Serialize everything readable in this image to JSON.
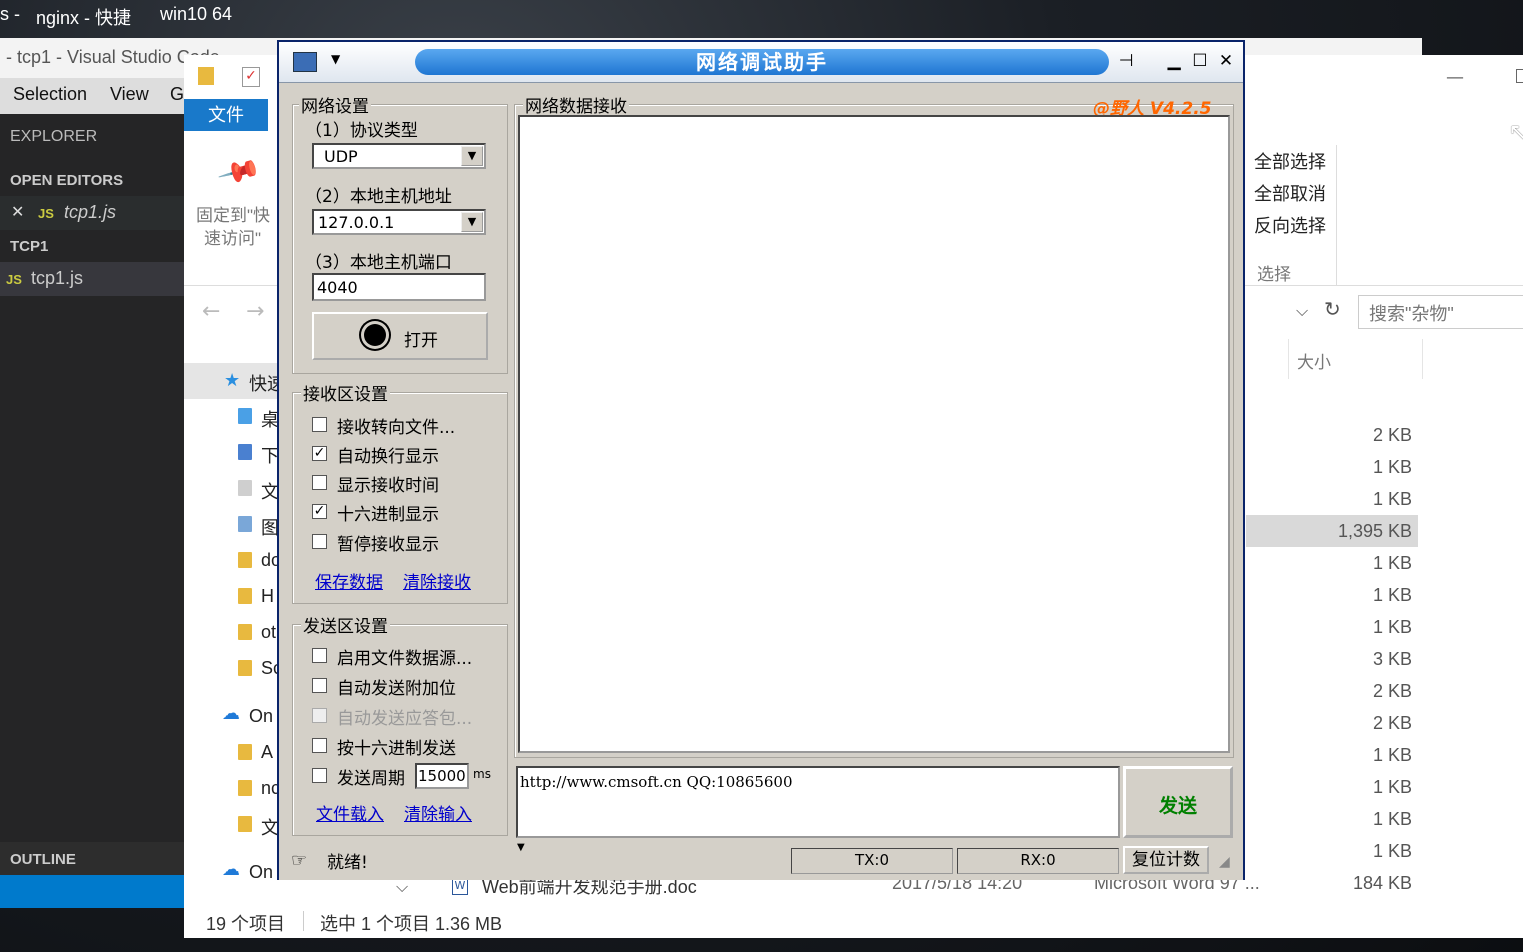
{
  "desktop": {
    "top_left_text_1": "s -",
    "top_left_text_2": "nginx - 快捷",
    "top_left_text_3": "win10 64"
  },
  "vscode": {
    "title": "- tcp1 - Visual Studio Code",
    "menu": [
      "Selection",
      "View",
      "G"
    ],
    "explorer_label": "EXPLORER",
    "open_editors_label": "OPEN EDITORS",
    "open_editor_file": "tcp1.js",
    "project_label": "TCP1",
    "project_file": "tcp1.js",
    "outline_label": "OUTLINE",
    "js_badge": "JS",
    "close_glyph": "✕"
  },
  "file_explorer": {
    "file_tab": "文件",
    "pin_label_1": "固定到\"快",
    "pin_label_2": "速访问\"",
    "select_all": "全部选择",
    "select_none": "全部取消",
    "invert_selection": "反向选择",
    "select_group": "选择",
    "search_placeholder": "搜索\"杂物\"",
    "size_header": "大小",
    "nav_items": [
      {
        "label": "快速"
      },
      {
        "label": "桌"
      },
      {
        "label": "下"
      },
      {
        "label": "文"
      },
      {
        "label": "图"
      },
      {
        "label": "do"
      },
      {
        "label": "H"
      },
      {
        "label": "ot"
      },
      {
        "label": "Sc"
      },
      {
        "label": "On"
      },
      {
        "label": "A"
      },
      {
        "label": "nc"
      },
      {
        "label": "文"
      },
      {
        "label": "On"
      }
    ],
    "sizes": [
      "2 KB",
      "1 KB",
      "1 KB",
      "1,395 KB",
      "1 KB",
      "1 KB",
      "1 KB",
      "3 KB",
      "2 KB",
      "2 KB",
      "1 KB",
      "1 KB",
      "1 KB",
      "1 KB"
    ],
    "last_row": {
      "name": "Web前端开发规范手册.doc",
      "date": "2017/5/18 14:20",
      "type": "Microsoft Word 97 ...",
      "size": "184 KB"
    },
    "status_count": "19 个项目",
    "status_selected": "选中 1 个项目  1.36 MB"
  },
  "app": {
    "title": "网络调试助手",
    "version": "@野人 V4.2.5",
    "net_settings": {
      "group_label": "网络设置",
      "protocol_label": "（1）协议类型",
      "protocol_value": "UDP",
      "host_label": "（2）本地主机地址",
      "host_value": "127.0.0.1",
      "port_label": "（3）本地主机端口",
      "port_value": "4040",
      "open_button": "打开"
    },
    "recv_settings": {
      "group_label": "接收区设置",
      "options": [
        {
          "label": "接收转向文件...",
          "checked": ""
        },
        {
          "label": "自动换行显示",
          "checked": "✓"
        },
        {
          "label": "显示接收时间",
          "checked": ""
        },
        {
          "label": "十六进制显示",
          "checked": "✓"
        },
        {
          "label": "暂停接收显示",
          "checked": ""
        }
      ],
      "save_link": "保存数据",
      "clear_link": "清除接收"
    },
    "send_settings": {
      "group_label": "发送区设置",
      "options": [
        {
          "label": "启用文件数据源...",
          "checked": ""
        },
        {
          "label": "自动发送附加位",
          "checked": ""
        },
        {
          "label": "自动发送应答包...",
          "checked": ""
        },
        {
          "label": "按十六进制发送",
          "checked": ""
        },
        {
          "label": "发送周期",
          "checked": ""
        }
      ],
      "period_value": "15000",
      "period_unit": "ms",
      "load_link": "文件载入",
      "clear_link": "清除输入"
    },
    "recv_area_label": "网络数据接收",
    "send_text": "http://www.cmsoft.cn QQ:10865600",
    "send_button": "发送",
    "status_text": "就绪!",
    "tx": "TX:0",
    "rx": "RX:0",
    "reset_button": "复位计数",
    "colors": {
      "title_blue": "#1f76d2",
      "version_orange": "#ff6600",
      "send_green": "#008000"
    }
  }
}
